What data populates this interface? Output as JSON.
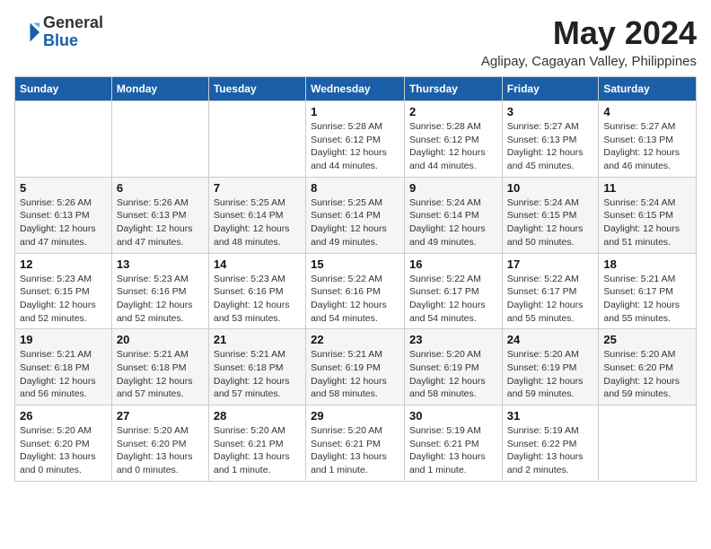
{
  "logo": {
    "general": "General",
    "blue": "Blue"
  },
  "header": {
    "month_year": "May 2024",
    "location": "Aglipay, Cagayan Valley, Philippines"
  },
  "weekdays": [
    "Sunday",
    "Monday",
    "Tuesday",
    "Wednesday",
    "Thursday",
    "Friday",
    "Saturday"
  ],
  "weeks": [
    [
      {
        "day": "",
        "sunrise": "",
        "sunset": "",
        "daylight": ""
      },
      {
        "day": "",
        "sunrise": "",
        "sunset": "",
        "daylight": ""
      },
      {
        "day": "",
        "sunrise": "",
        "sunset": "",
        "daylight": ""
      },
      {
        "day": "1",
        "sunrise": "Sunrise: 5:28 AM",
        "sunset": "Sunset: 6:12 PM",
        "daylight": "Daylight: 12 hours and 44 minutes."
      },
      {
        "day": "2",
        "sunrise": "Sunrise: 5:28 AM",
        "sunset": "Sunset: 6:12 PM",
        "daylight": "Daylight: 12 hours and 44 minutes."
      },
      {
        "day": "3",
        "sunrise": "Sunrise: 5:27 AM",
        "sunset": "Sunset: 6:13 PM",
        "daylight": "Daylight: 12 hours and 45 minutes."
      },
      {
        "day": "4",
        "sunrise": "Sunrise: 5:27 AM",
        "sunset": "Sunset: 6:13 PM",
        "daylight": "Daylight: 12 hours and 46 minutes."
      }
    ],
    [
      {
        "day": "5",
        "sunrise": "Sunrise: 5:26 AM",
        "sunset": "Sunset: 6:13 PM",
        "daylight": "Daylight: 12 hours and 47 minutes."
      },
      {
        "day": "6",
        "sunrise": "Sunrise: 5:26 AM",
        "sunset": "Sunset: 6:13 PM",
        "daylight": "Daylight: 12 hours and 47 minutes."
      },
      {
        "day": "7",
        "sunrise": "Sunrise: 5:25 AM",
        "sunset": "Sunset: 6:14 PM",
        "daylight": "Daylight: 12 hours and 48 minutes."
      },
      {
        "day": "8",
        "sunrise": "Sunrise: 5:25 AM",
        "sunset": "Sunset: 6:14 PM",
        "daylight": "Daylight: 12 hours and 49 minutes."
      },
      {
        "day": "9",
        "sunrise": "Sunrise: 5:24 AM",
        "sunset": "Sunset: 6:14 PM",
        "daylight": "Daylight: 12 hours and 49 minutes."
      },
      {
        "day": "10",
        "sunrise": "Sunrise: 5:24 AM",
        "sunset": "Sunset: 6:15 PM",
        "daylight": "Daylight: 12 hours and 50 minutes."
      },
      {
        "day": "11",
        "sunrise": "Sunrise: 5:24 AM",
        "sunset": "Sunset: 6:15 PM",
        "daylight": "Daylight: 12 hours and 51 minutes."
      }
    ],
    [
      {
        "day": "12",
        "sunrise": "Sunrise: 5:23 AM",
        "sunset": "Sunset: 6:15 PM",
        "daylight": "Daylight: 12 hours and 52 minutes."
      },
      {
        "day": "13",
        "sunrise": "Sunrise: 5:23 AM",
        "sunset": "Sunset: 6:16 PM",
        "daylight": "Daylight: 12 hours and 52 minutes."
      },
      {
        "day": "14",
        "sunrise": "Sunrise: 5:23 AM",
        "sunset": "Sunset: 6:16 PM",
        "daylight": "Daylight: 12 hours and 53 minutes."
      },
      {
        "day": "15",
        "sunrise": "Sunrise: 5:22 AM",
        "sunset": "Sunset: 6:16 PM",
        "daylight": "Daylight: 12 hours and 54 minutes."
      },
      {
        "day": "16",
        "sunrise": "Sunrise: 5:22 AM",
        "sunset": "Sunset: 6:17 PM",
        "daylight": "Daylight: 12 hours and 54 minutes."
      },
      {
        "day": "17",
        "sunrise": "Sunrise: 5:22 AM",
        "sunset": "Sunset: 6:17 PM",
        "daylight": "Daylight: 12 hours and 55 minutes."
      },
      {
        "day": "18",
        "sunrise": "Sunrise: 5:21 AM",
        "sunset": "Sunset: 6:17 PM",
        "daylight": "Daylight: 12 hours and 55 minutes."
      }
    ],
    [
      {
        "day": "19",
        "sunrise": "Sunrise: 5:21 AM",
        "sunset": "Sunset: 6:18 PM",
        "daylight": "Daylight: 12 hours and 56 minutes."
      },
      {
        "day": "20",
        "sunrise": "Sunrise: 5:21 AM",
        "sunset": "Sunset: 6:18 PM",
        "daylight": "Daylight: 12 hours and 57 minutes."
      },
      {
        "day": "21",
        "sunrise": "Sunrise: 5:21 AM",
        "sunset": "Sunset: 6:18 PM",
        "daylight": "Daylight: 12 hours and 57 minutes."
      },
      {
        "day": "22",
        "sunrise": "Sunrise: 5:21 AM",
        "sunset": "Sunset: 6:19 PM",
        "daylight": "Daylight: 12 hours and 58 minutes."
      },
      {
        "day": "23",
        "sunrise": "Sunrise: 5:20 AM",
        "sunset": "Sunset: 6:19 PM",
        "daylight": "Daylight: 12 hours and 58 minutes."
      },
      {
        "day": "24",
        "sunrise": "Sunrise: 5:20 AM",
        "sunset": "Sunset: 6:19 PM",
        "daylight": "Daylight: 12 hours and 59 minutes."
      },
      {
        "day": "25",
        "sunrise": "Sunrise: 5:20 AM",
        "sunset": "Sunset: 6:20 PM",
        "daylight": "Daylight: 12 hours and 59 minutes."
      }
    ],
    [
      {
        "day": "26",
        "sunrise": "Sunrise: 5:20 AM",
        "sunset": "Sunset: 6:20 PM",
        "daylight": "Daylight: 13 hours and 0 minutes."
      },
      {
        "day": "27",
        "sunrise": "Sunrise: 5:20 AM",
        "sunset": "Sunset: 6:20 PM",
        "daylight": "Daylight: 13 hours and 0 minutes."
      },
      {
        "day": "28",
        "sunrise": "Sunrise: 5:20 AM",
        "sunset": "Sunset: 6:21 PM",
        "daylight": "Daylight: 13 hours and 1 minute."
      },
      {
        "day": "29",
        "sunrise": "Sunrise: 5:20 AM",
        "sunset": "Sunset: 6:21 PM",
        "daylight": "Daylight: 13 hours and 1 minute."
      },
      {
        "day": "30",
        "sunrise": "Sunrise: 5:19 AM",
        "sunset": "Sunset: 6:21 PM",
        "daylight": "Daylight: 13 hours and 1 minute."
      },
      {
        "day": "31",
        "sunrise": "Sunrise: 5:19 AM",
        "sunset": "Sunset: 6:22 PM",
        "daylight": "Daylight: 13 hours and 2 minutes."
      },
      {
        "day": "",
        "sunrise": "",
        "sunset": "",
        "daylight": ""
      }
    ]
  ]
}
